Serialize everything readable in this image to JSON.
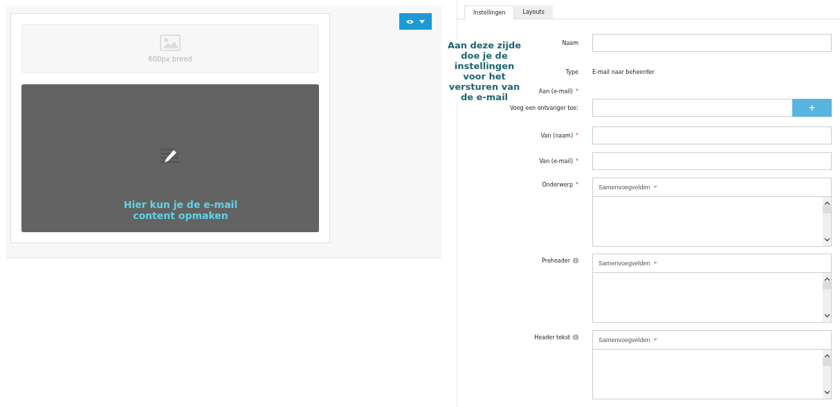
{
  "preview": {
    "image_placeholder": {
      "caption": "600px breed"
    },
    "content_block": {
      "annotation": "Hier kun je de e-mail content opmaken"
    }
  },
  "tabs": [
    {
      "label": "Instellingen",
      "selected": true
    },
    {
      "label": "Layouts",
      "selected": false
    }
  ],
  "annotation": "Aan deze zijde doe je de instellingen voor het versturen van de e-mail",
  "fields": [
    {
      "kind": "text",
      "label": "Naam"
    },
    {
      "kind": "static",
      "label": "Type",
      "value": "E-mail naar beheerder"
    },
    {
      "kind": "heading",
      "label": "Aan (e-mail)",
      "required_mark": "*"
    },
    {
      "kind": "add",
      "label": "Voeg een ontvanger toe:",
      "button": "+"
    },
    {
      "kind": "text",
      "label": "Van (naam)",
      "required_mark": "*"
    },
    {
      "kind": "text",
      "label": "Van (e-mail)",
      "required_mark": "*"
    },
    {
      "kind": "rich",
      "label": "Onderwerp",
      "dropdown": "Samenvoegvelden",
      "required_mark": "*"
    },
    {
      "kind": "rich",
      "label": "Preheader",
      "dropdown": "Samenvoegvelden",
      "info": true
    },
    {
      "kind": "rich",
      "label": "Header tekst",
      "dropdown": "Samenvoegvelden",
      "info": true
    }
  ]
}
